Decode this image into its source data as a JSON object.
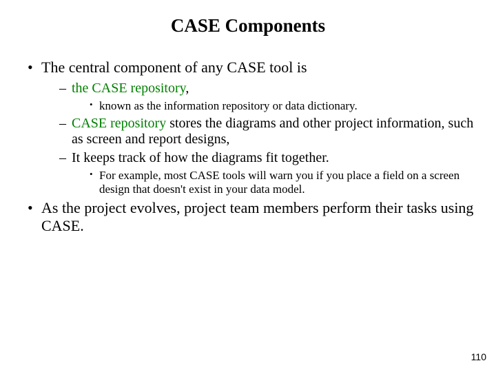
{
  "title": "CASE Components",
  "bullets": {
    "b1": "The central component of any CASE tool is",
    "b1_1_green": "the CASE repository",
    "b1_1_rest": ",",
    "b1_1_1": "known as the information repository or data dictionary.",
    "b1_2_green": "CASE repository",
    "b1_2_rest": " stores the diagrams and other project information, such as screen and report designs,",
    "b1_3": "It keeps track of how the diagrams fit together.",
    "b1_3_1": "For example, most CASE tools will warn you if you place a field on a screen design that doesn't exist in your data model.",
    "b2": "As the project evolves, project team members perform their tasks using CASE."
  },
  "page_number": "110"
}
